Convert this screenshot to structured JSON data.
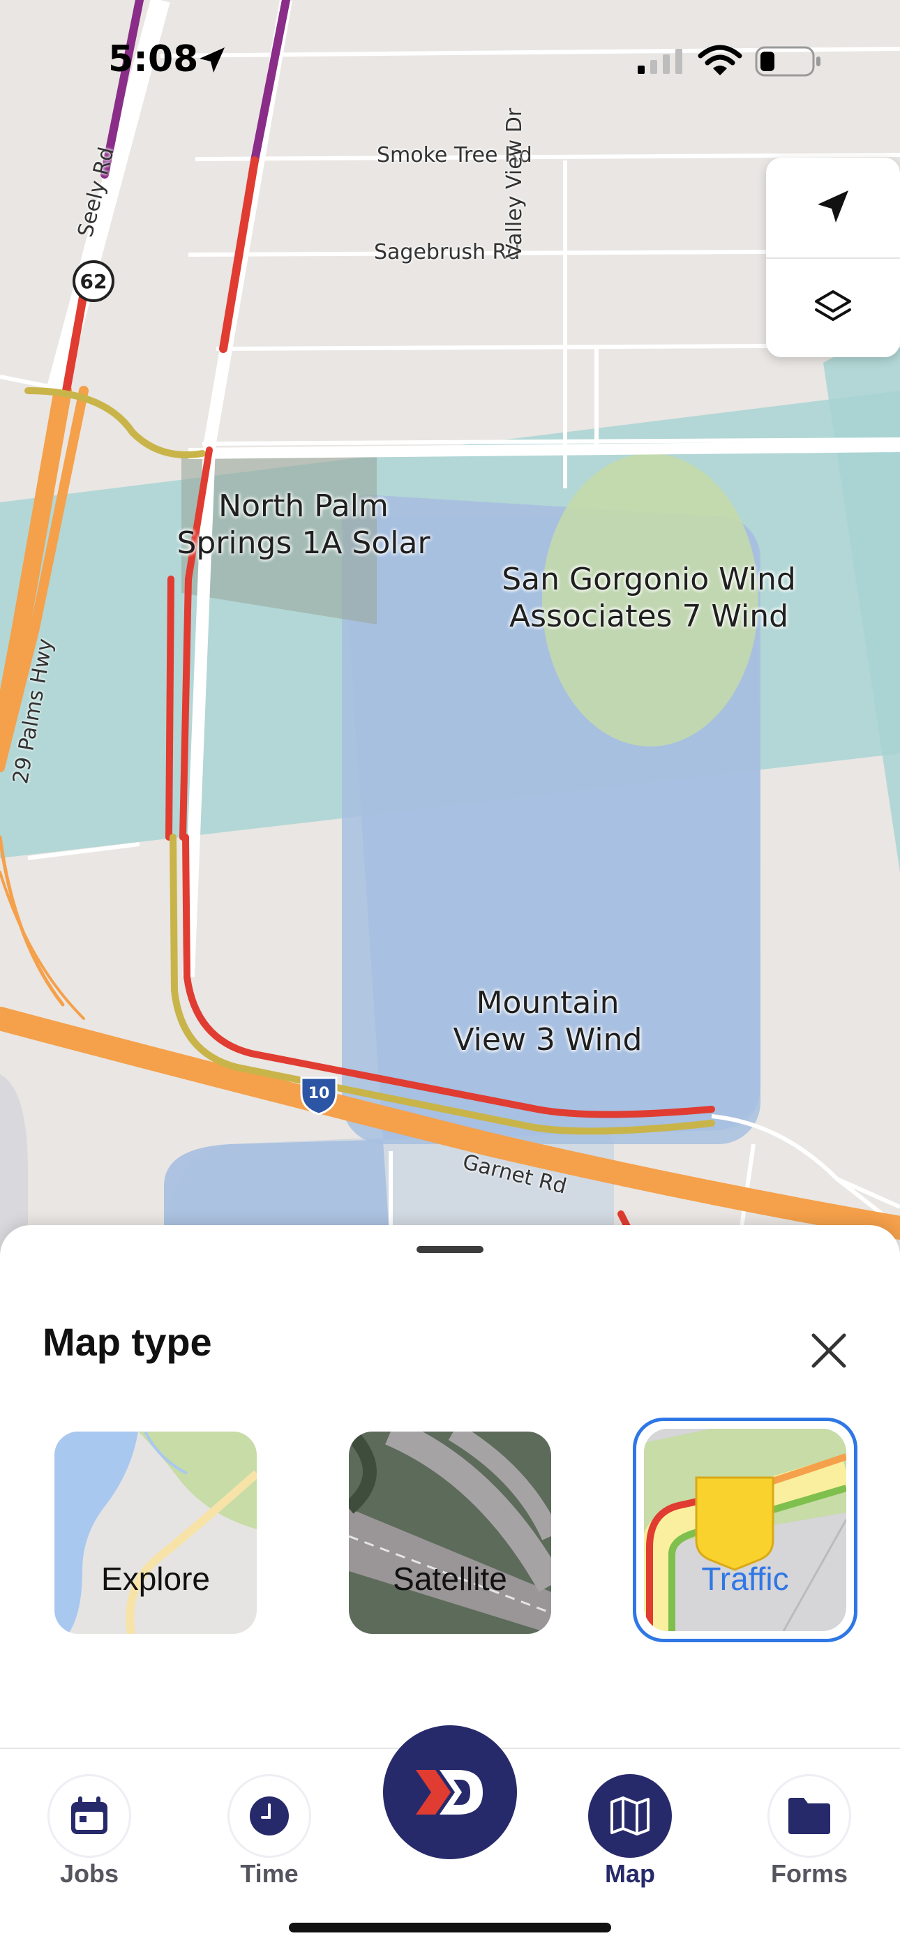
{
  "status_bar": {
    "time": "5:08"
  },
  "map": {
    "poi_labels": [
      {
        "id": "north-palm",
        "lines": [
          "North Palm",
          "Springs 1A Solar"
        ]
      },
      {
        "id": "san-gorgonio",
        "lines": [
          "San Gorgonio Wind",
          "Associates 7 Wind"
        ]
      },
      {
        "id": "mountain-view",
        "lines": [
          "Mountain",
          "View 3 Wind"
        ]
      }
    ],
    "road_labels": {
      "smoke_tree": "Smoke Tree Rd",
      "sagebrush": "Sagebrush Rd",
      "valley_view": "Valley View Dr",
      "seely": "Seely Rd",
      "palms_hwy": "29 Palms Hwy",
      "garnet": "Garnet Rd",
      "shield_62": "62",
      "shield_10": "10"
    },
    "controls": {
      "locate_icon": "navigation-arrow-icon",
      "layers_icon": "layers-icon"
    }
  },
  "sheet": {
    "title": "Map type",
    "options": [
      {
        "id": "explore",
        "label": "Explore",
        "selected": false
      },
      {
        "id": "satellite",
        "label": "Satellite",
        "selected": false
      },
      {
        "id": "traffic",
        "label": "Traffic",
        "selected": true
      }
    ]
  },
  "tabs": [
    {
      "id": "jobs",
      "label": "Jobs",
      "icon": "calendar-icon",
      "active": false
    },
    {
      "id": "time",
      "label": "Time",
      "icon": "clock-icon",
      "active": false
    },
    {
      "id": "home",
      "label": "",
      "icon": "brand-logo-icon",
      "active": false
    },
    {
      "id": "map",
      "label": "Map",
      "icon": "map-icon",
      "active": true
    },
    {
      "id": "forms",
      "label": "Forms",
      "icon": "folder-icon",
      "active": false
    }
  ],
  "colors": {
    "accent": "#2f77e5",
    "brand_navy": "#272a6a",
    "traffic_red": "#e03c31",
    "traffic_yellow": "#c9b44a",
    "highway_orange": "#f5a04a"
  }
}
